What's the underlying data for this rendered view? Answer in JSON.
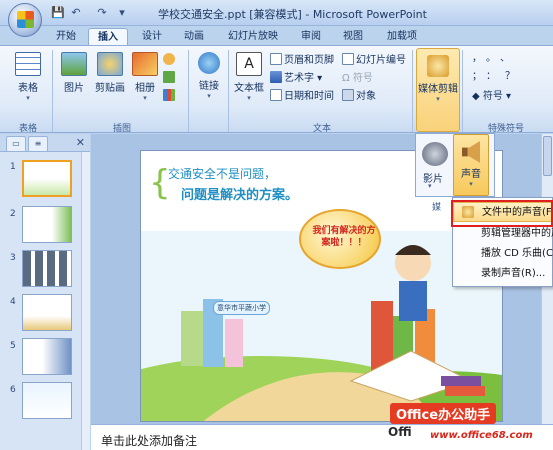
{
  "window": {
    "title": "学校交通安全.ppt [兼容模式] - Microsoft PowerPoint"
  },
  "quick_access": {
    "save_icon": "save-icon",
    "undo_icon": "undo-icon",
    "redo_icon": "redo-icon"
  },
  "tabs": [
    {
      "label": "开始"
    },
    {
      "label": "插入",
      "active": true
    },
    {
      "label": "设计"
    },
    {
      "label": "动画"
    },
    {
      "label": "幻灯片放映"
    },
    {
      "label": "审阅"
    },
    {
      "label": "视图"
    },
    {
      "label": "加载项"
    }
  ],
  "ribbon": {
    "table_group": {
      "button": "表格",
      "label": "表格"
    },
    "illustrations_group": {
      "label": "插图",
      "buttons": [
        "图片",
        "剪贴画",
        "相册"
      ]
    },
    "links_group": {
      "button": "链接"
    },
    "text_group": {
      "label": "文本",
      "textbox": "文本框",
      "header_footer": "页眉和页脚",
      "slide_number": "幻灯片编号",
      "wordart": "艺术字",
      "symbol": "符号",
      "date_time": "日期和时间",
      "object": "对象"
    },
    "media_group": {
      "button": "媒体剪辑",
      "movie": "影片",
      "sound": "声音",
      "label_partial": "媒"
    },
    "special_symbols_group": {
      "label": "特殊符号",
      "symbol_button": "符号",
      "glyphs": [
        "，",
        "。",
        "、",
        "；",
        "：",
        "？"
      ]
    }
  },
  "sound_menu": {
    "items": [
      {
        "label": "文件中的声音(F)...",
        "highlighted": true
      },
      {
        "label": "剪辑管理器中的声音(S)..."
      },
      {
        "label": "播放 CD 乐曲(C)..."
      },
      {
        "label": "录制声音(R)..."
      }
    ]
  },
  "slides": [
    {
      "number": "1",
      "selected": true
    },
    {
      "number": "2"
    },
    {
      "number": "3"
    },
    {
      "number": "4"
    },
    {
      "number": "5"
    },
    {
      "number": "6"
    }
  ],
  "slide_content": {
    "title_line1": "交通安全不是问题，",
    "title_line2": "问题是解决的方案。",
    "bubble": "我们有解决的方案啦！！！",
    "sign": "意华市平蔬小学"
  },
  "notes": {
    "placeholder": "单击此处添加备注"
  },
  "watermark": {
    "main": "Office办公助手",
    "sub": "Offi",
    "site": "www.office68.com"
  },
  "colors": {
    "ribbon_accent": "#f7c95c",
    "highlight_border": "#e02020",
    "title_text": "#1f8fc4"
  }
}
